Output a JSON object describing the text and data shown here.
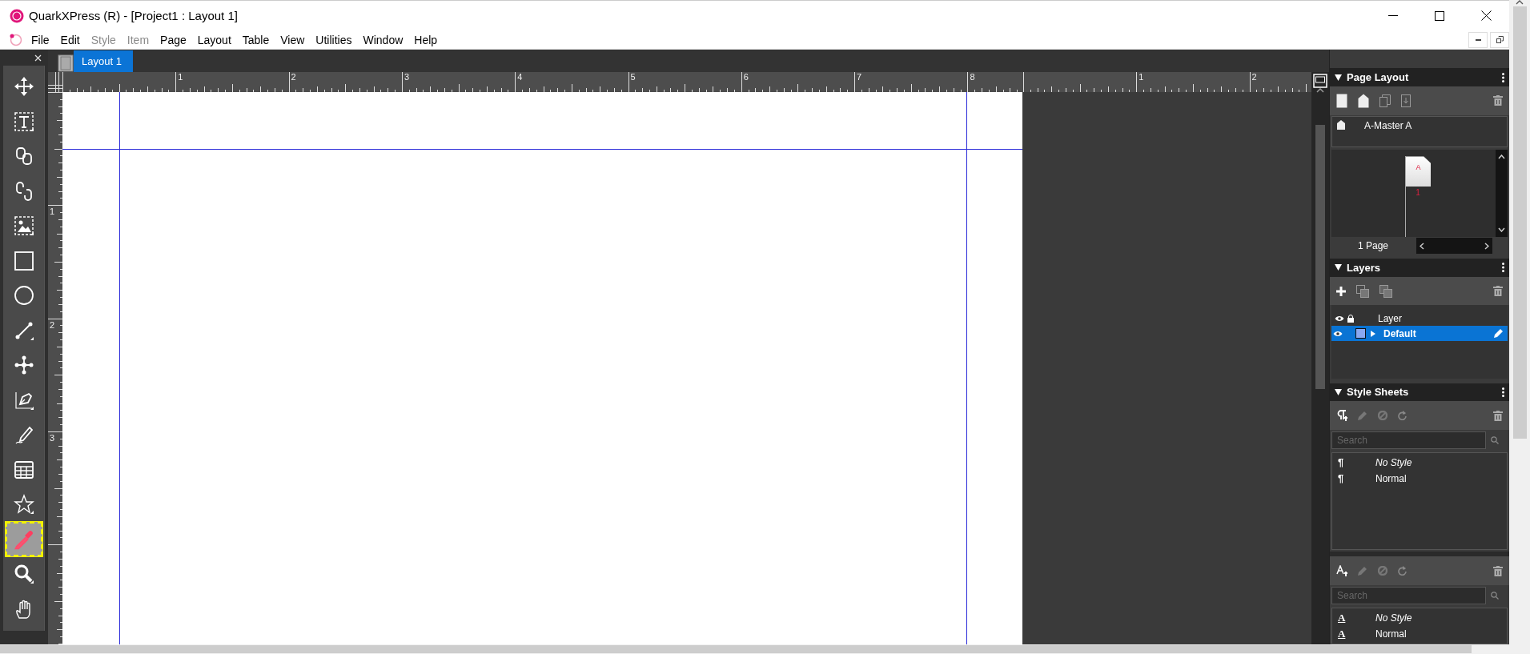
{
  "window": {
    "title": "QuarkXPress (R) - [Project1 : Layout 1]"
  },
  "menu": [
    {
      "label": "File",
      "disabled": false
    },
    {
      "label": "Edit",
      "disabled": false
    },
    {
      "label": "Style",
      "disabled": true
    },
    {
      "label": "Item",
      "disabled": true
    },
    {
      "label": "Page",
      "disabled": false
    },
    {
      "label": "Layout",
      "disabled": false
    },
    {
      "label": "Table",
      "disabled": false
    },
    {
      "label": "View",
      "disabled": false
    },
    {
      "label": "Utilities",
      "disabled": false
    },
    {
      "label": "Window",
      "disabled": false
    },
    {
      "label": "Help",
      "disabled": false
    }
  ],
  "layout_tabs": [
    {
      "label": "Layout 1",
      "selected": true
    }
  ],
  "tools": [
    {
      "kind": "move",
      "selected": false
    },
    {
      "kind": "text",
      "selected": false
    },
    {
      "kind": "link",
      "selected": false
    },
    {
      "kind": "unlink",
      "selected": false
    },
    {
      "kind": "picture",
      "selected": false
    },
    {
      "kind": "rectangle",
      "selected": false
    },
    {
      "kind": "oval",
      "selected": false
    },
    {
      "kind": "line",
      "selected": false
    },
    {
      "kind": "bezier",
      "selected": false
    },
    {
      "kind": "pen",
      "selected": false
    },
    {
      "kind": "pencil",
      "selected": false
    },
    {
      "kind": "table",
      "selected": false
    },
    {
      "kind": "star",
      "selected": false
    },
    {
      "kind": "eyedropper",
      "selected": true
    },
    {
      "kind": "zoom",
      "selected": false
    },
    {
      "kind": "hand",
      "selected": false
    }
  ],
  "rulers": {
    "horizontal": {
      "page": [
        "1",
        "2",
        "3",
        "4",
        "5",
        "6",
        "7",
        "8"
      ],
      "pasteboard": [
        "1",
        "2"
      ]
    },
    "vertical": [
      "1",
      "2",
      "3"
    ]
  },
  "page_layout": {
    "title": "Page Layout",
    "masters": [
      {
        "label": "A-Master A"
      }
    ],
    "pages": [
      {
        "master": "A",
        "number": "1"
      }
    ],
    "page_count": "1 Page"
  },
  "layers": {
    "title": "Layers",
    "header": "Layer",
    "items": [
      {
        "name": "Default",
        "selected": true,
        "visible": true,
        "color": "#8aa8f0"
      }
    ]
  },
  "style_sheets": {
    "title": "Style Sheets",
    "paragraph": {
      "placeholder": "Search",
      "items": [
        {
          "marker": "¶",
          "name": "No Style",
          "italic": true
        },
        {
          "marker": "¶",
          "name": "Normal",
          "italic": false
        }
      ]
    },
    "character": {
      "placeholder": "Search",
      "items": [
        {
          "marker": "A",
          "name": "No Style",
          "italic": true
        },
        {
          "marker": "A",
          "name": "Normal",
          "italic": false
        }
      ]
    }
  }
}
